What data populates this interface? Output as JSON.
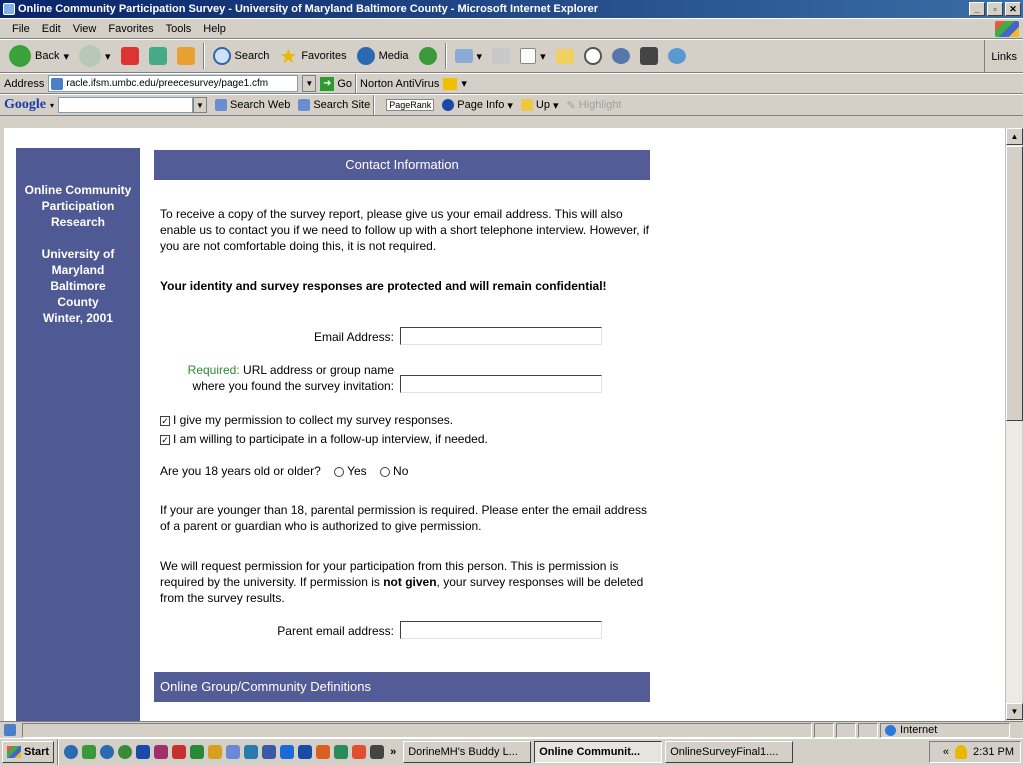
{
  "window": {
    "title": "Online Community Participation Survey - University of Maryland Baltimore County - Microsoft Internet Explorer"
  },
  "menu": [
    "File",
    "Edit",
    "View",
    "Favorites",
    "Tools",
    "Help"
  ],
  "toolbar": {
    "back": "Back",
    "search": "Search",
    "favorites": "Favorites",
    "media": "Media",
    "links": "Links"
  },
  "address": {
    "label": "Address",
    "url": "racle.ifsm.umbc.edu/preecesurvey/page1.cfm",
    "go": "Go",
    "norton": "Norton AntiVirus"
  },
  "google": {
    "logo": "Google",
    "search_web": "Search Web",
    "search_site": "Search Site",
    "pagerank": "PageRank",
    "page_info": "Page Info",
    "up": "Up",
    "highlight": "Highlight"
  },
  "sidebar": {
    "line1": "Online Community",
    "line2": "Participation",
    "line3": "Research",
    "line4": "University of",
    "line5": "Maryland",
    "line6": "Baltimore",
    "line7": "County",
    "line8": "Winter, 2001"
  },
  "form": {
    "header": "Contact Information",
    "intro": "To receive a copy of the survey report, please give us your email address. This will also enable us to contact you if we need to follow up with a short telephone interview. However, if you are not comfortable doing this, it is not required.",
    "confidential": "Your identity and survey responses are protected and will remain confidential!",
    "email_label": "Email Address:",
    "email_value": "",
    "required_label": "Required:",
    "url_label_1": " URL address or group name",
    "url_label_2": "where you found the survey invitation:",
    "url_value": "",
    "perm1": "I give my permission to collect my survey responses.",
    "perm2": "I am willing to participate in a follow-up interview, if needed.",
    "age_question": "Are you 18 years old or older?",
    "yes": "Yes",
    "no": "No",
    "younger": "If your are younger than 18, parental permission is required. Please enter the email address of a parent or guardian who is authorized to give permission.",
    "request_1": "We will request permission for your participation from this person. This is permission is required by the university. If permission is ",
    "request_bold": "not given",
    "request_2": ", your survey responses will be deleted from the survey results.",
    "parent_label": "Parent email address:",
    "parent_value": "",
    "section2": "Online Group/Community Definitions"
  },
  "status": {
    "zone": "Internet"
  },
  "taskbar": {
    "start": "Start",
    "task1": "DorineMH's Buddy L...",
    "task2": "Online Communit...",
    "task3": "OnlineSurveyFinal1....",
    "clock": "2:31 PM"
  },
  "colors": {
    "header_blue": "#535c96",
    "sidebar_blue": "#4f5a94",
    "required_green": "#2e8b2e"
  }
}
